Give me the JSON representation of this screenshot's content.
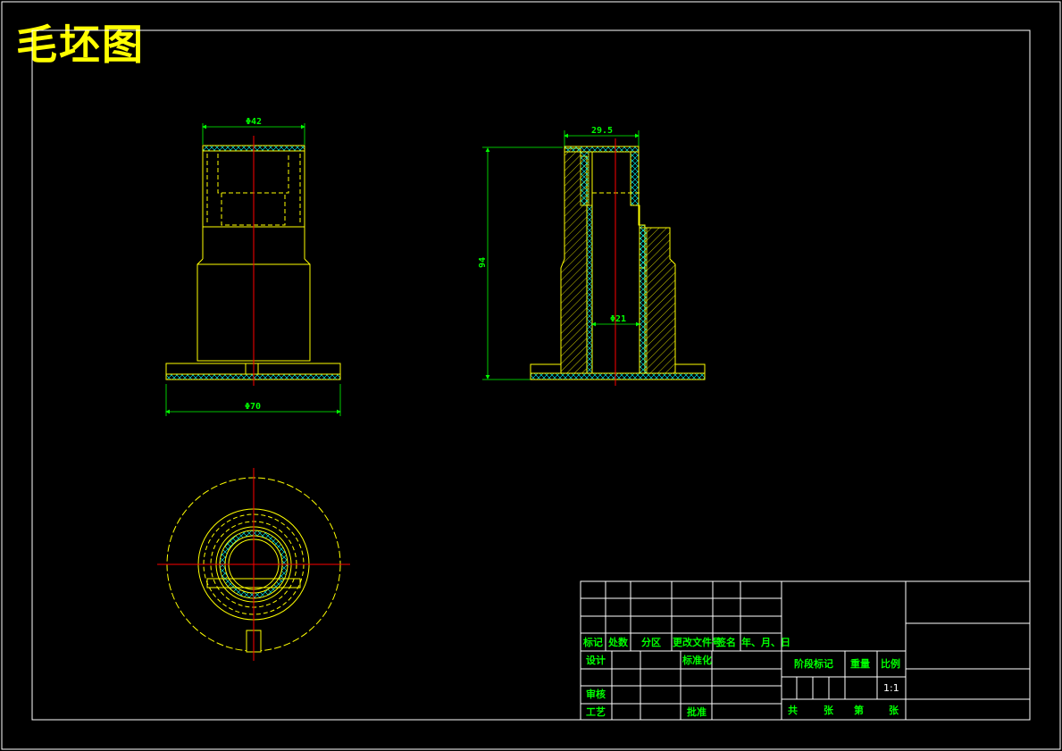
{
  "title": "毛坯图",
  "dimensions": {
    "front_top_diameter": "Φ42",
    "front_base_diameter": "Φ70",
    "section_top_width": "29.5",
    "section_height": "94",
    "section_bore_diameter": "Φ21"
  },
  "title_block": {
    "header": [
      "标记",
      "处数",
      "分区",
      "更改文件号",
      "签名",
      "年、月、日"
    ],
    "design": "设计",
    "standardize": "标准化",
    "review": "审核",
    "process": "工艺",
    "approve": "批准",
    "stage_mark": "阶段标记",
    "weight": "重量",
    "scale_label": "比例",
    "scale_value": "1:1",
    "total": "共",
    "sheets": "张",
    "number": "第",
    "sheet": "张"
  },
  "colors": {
    "background": "#000000",
    "border": "#ffffff",
    "outline": "#ffff00",
    "centerline": "#ff0000",
    "dimension": "#00ff00",
    "hatch": "#00ffff"
  }
}
